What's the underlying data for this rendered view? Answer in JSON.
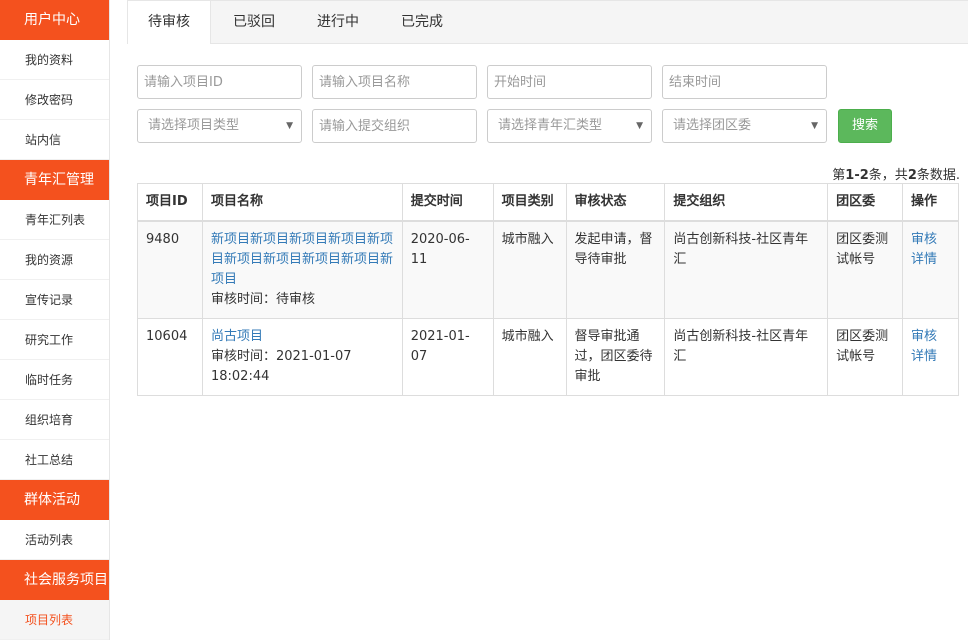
{
  "sidebar": {
    "groups": [
      {
        "title": "用户中心",
        "items": [
          "我的资料",
          "修改密码",
          "站内信"
        ]
      },
      {
        "title": "青年汇管理",
        "items": [
          "青年汇列表",
          "我的资源",
          "宣传记录",
          "研究工作",
          "临时任务",
          "组织培育",
          "社工总结"
        ]
      },
      {
        "title": "群体活动",
        "items": [
          "活动列表"
        ]
      },
      {
        "title": "社会服务项目",
        "items": [
          "项目列表"
        ]
      }
    ]
  },
  "tabs": [
    "待审核",
    "已驳回",
    "进行中",
    "已完成"
  ],
  "filters": {
    "project_id_placeholder": "请输入项目ID",
    "project_name_placeholder": "请输入项目名称",
    "start_time_placeholder": "开始时间",
    "end_time_placeholder": "结束时间",
    "project_type_placeholder": "请选择项目类型",
    "submit_org_placeholder": "请输入提交组织",
    "youth_type_placeholder": "请选择青年汇类型",
    "district_placeholder": "请选择团区委",
    "search_label": "搜索"
  },
  "summary": {
    "prefix": "第",
    "range": "1-2",
    "mid": "条，共",
    "total": "2",
    "suffix": "条数据."
  },
  "table": {
    "headers": [
      "项目ID",
      "项目名称",
      "提交时间",
      "项目类别",
      "审核状态",
      "提交组织",
      "团区委",
      "操作"
    ],
    "rows": [
      {
        "id": "9480",
        "name": "新项目新项目新项目新项目新项目新项目新项目新项目新项目新项目",
        "review_time": "审核时间：待审核",
        "submit_time": "2020-06-11",
        "category": "城市融入",
        "status": "发起申请，督导待审批",
        "org": "尚古创新科技-社区青年汇",
        "district": "团区委测试帐号",
        "action_review": "审核",
        "action_detail": "详情"
      },
      {
        "id": "10604",
        "name": "尚古项目",
        "review_time": "审核时间：2021-01-07 18:02:44",
        "submit_time": "2021-01-07",
        "category": "城市融入",
        "status": "督导审批通过，团区委待审批",
        "org": "尚古创新科技-社区青年汇",
        "district": "团区委测试帐号",
        "action_review": "审核",
        "action_detail": "详情"
      }
    ]
  }
}
